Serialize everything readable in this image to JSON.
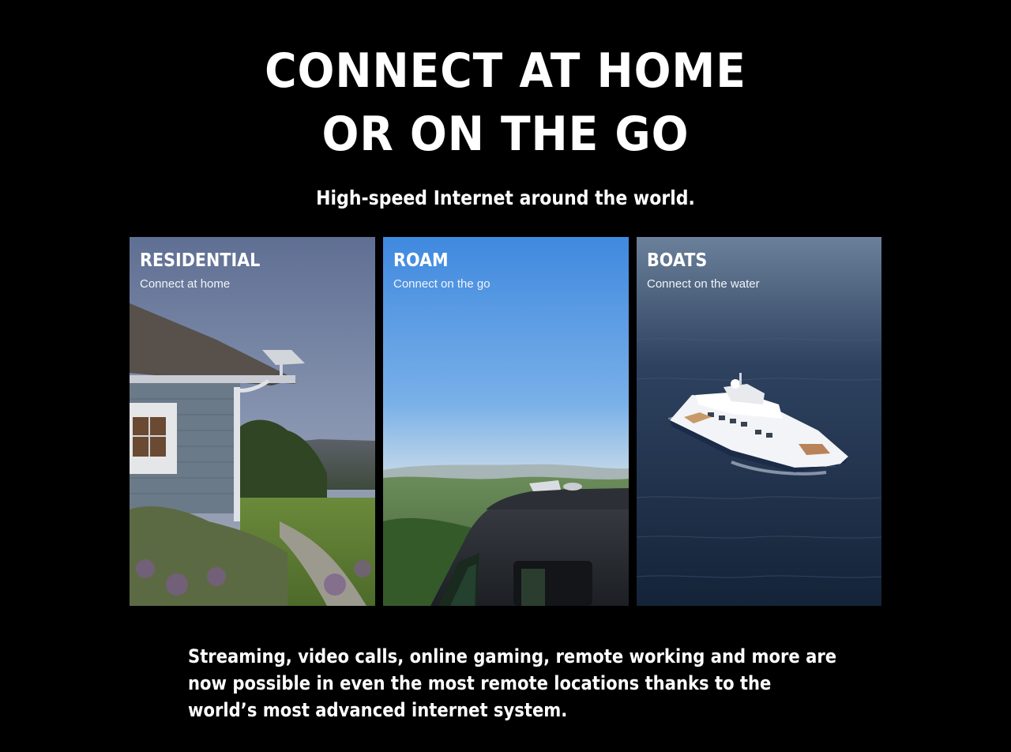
{
  "hero": {
    "headline_line1": "CONNECT AT HOME",
    "headline_line2": "OR ON THE GO",
    "subheadline": "High-speed Internet around the world."
  },
  "cards": [
    {
      "title": "RESIDENTIAL",
      "subtitle": "Connect at home"
    },
    {
      "title": "ROAM",
      "subtitle": "Connect on the go"
    },
    {
      "title": "BOATS",
      "subtitle": "Connect on the water"
    }
  ],
  "description": "Streaming, video calls, online gaming, remote working and more are now possible in even the most remote locations thanks to the world’s most advanced internet system.",
  "colors": {
    "background": "#000000",
    "text": "#ffffff"
  }
}
